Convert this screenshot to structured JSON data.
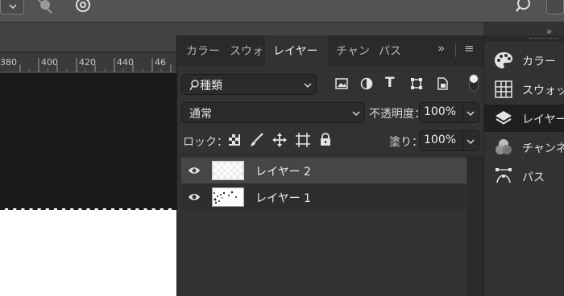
{
  "ruler": {
    "ticks": [
      "380",
      "400",
      "420",
      "440",
      "46"
    ]
  },
  "layers_panel": {
    "tabs": [
      "カラー",
      "スウォ",
      "レイヤー",
      "チャン",
      "パス"
    ],
    "active_tab": 2,
    "menu_glyph": "≡",
    "overflow_glyph": "»",
    "filter": {
      "value": "種類"
    },
    "blend_mode": {
      "value": "通常"
    },
    "opacity": {
      "label": "不透明度：",
      "value": "100%"
    },
    "lock": {
      "label": "ロック："
    },
    "fill": {
      "label": "塗り：",
      "value": "100%"
    },
    "layers": [
      {
        "name": "レイヤー 2",
        "selected": true,
        "visible": true
      },
      {
        "name": "レイヤー 1",
        "selected": false,
        "visible": true
      }
    ]
  },
  "dock": {
    "collapse_glyph": "»",
    "items": [
      {
        "label": "カラー",
        "icon": "palette-icon"
      },
      {
        "label": "スウォッ",
        "icon": "swatches-grid-icon"
      },
      {
        "label": "レイヤー",
        "icon": "layers-icon"
      },
      {
        "label": "チャンネ",
        "icon": "channels-icon"
      },
      {
        "label": "パス",
        "icon": "paths-pen-icon"
      }
    ]
  },
  "colors": {
    "panel_bg": "#323232",
    "tab_bar_bg": "#2a2a2a",
    "selected_row": "#464646",
    "canvas_bg": "#191919",
    "paper": "#ffffff"
  }
}
